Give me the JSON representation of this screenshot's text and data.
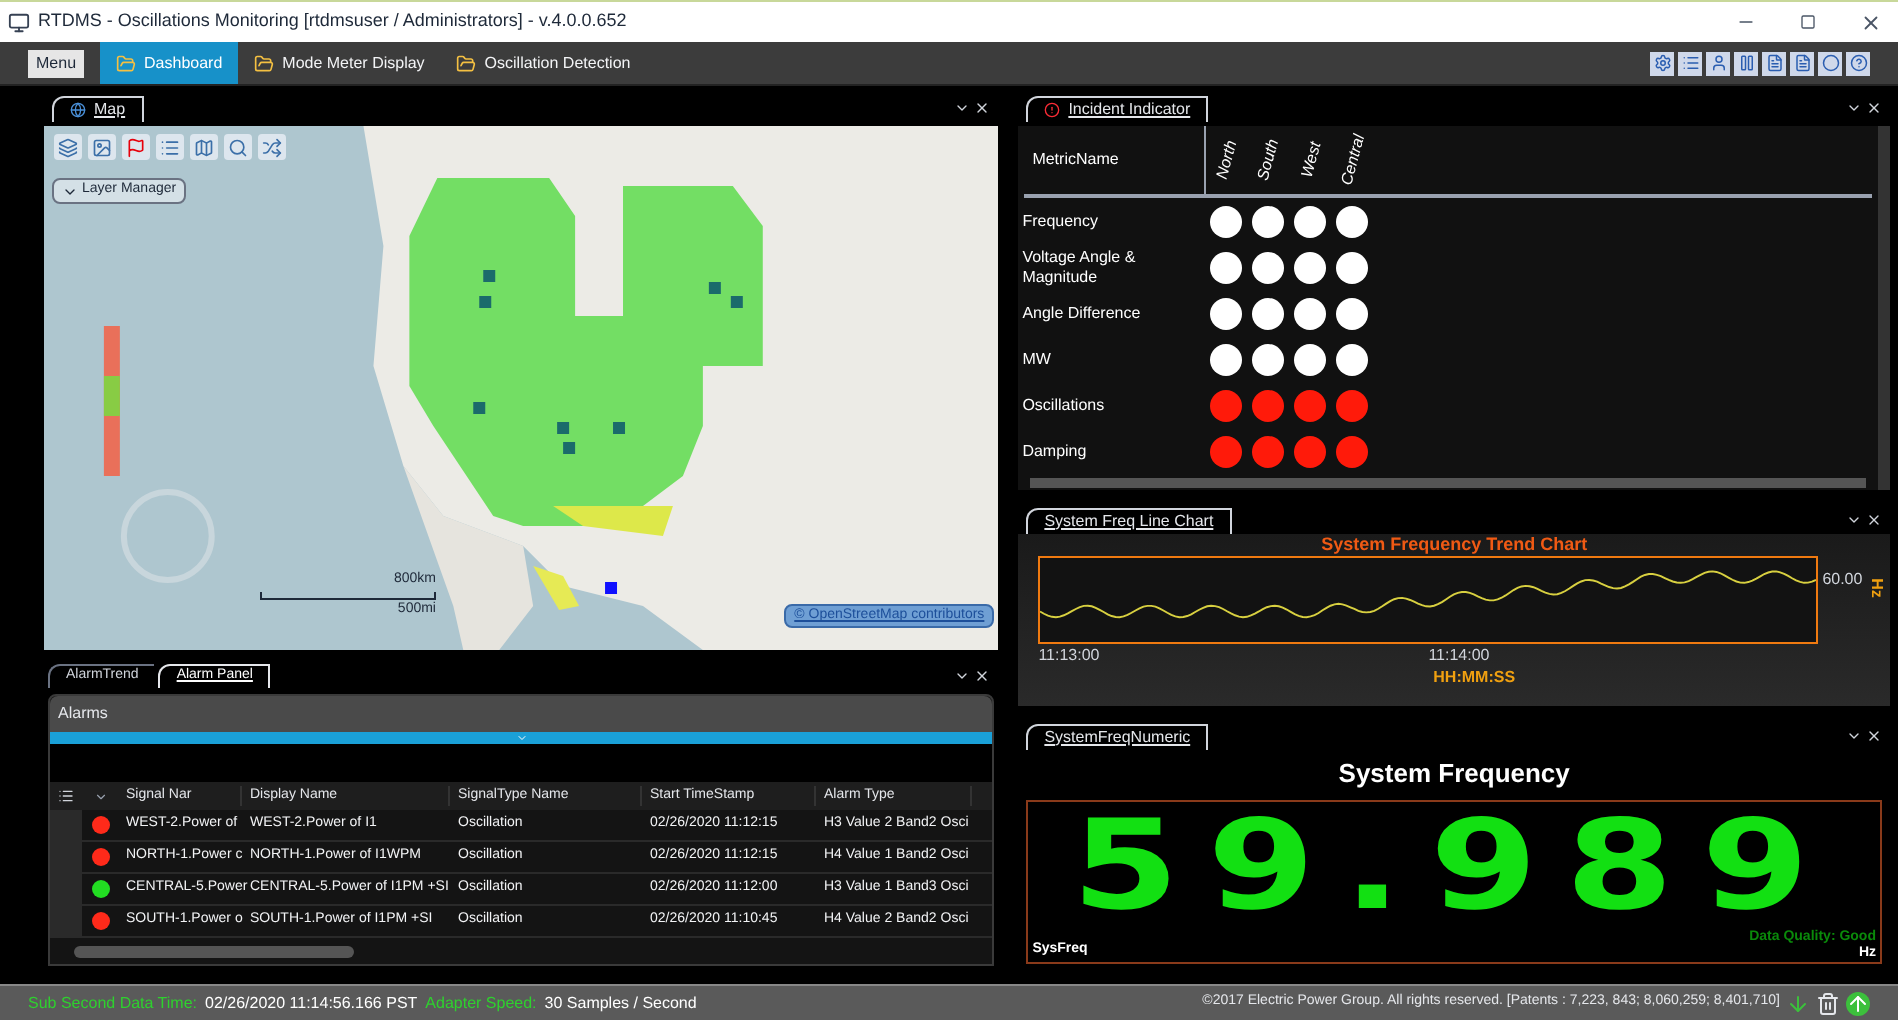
{
  "window": {
    "title": "RTDMS - Oscillations Monitoring [rtdmsuser / Administrators] - v.4.0.0.652"
  },
  "menu_button": "Menu",
  "tabs": [
    {
      "label": "Dashboard",
      "selected": true
    },
    {
      "label": "Mode Meter Display",
      "selected": false
    },
    {
      "label": "Oscillation Detection",
      "selected": false
    }
  ],
  "map_panel": {
    "tab": "Map",
    "layer_manager": "Layer Manager",
    "scale": [
      "800km",
      "500mi"
    ],
    "attribution": "© OpenStreetMap contributors"
  },
  "incident_panel": {
    "tab": "Incident Indicator",
    "header": "MetricName",
    "regions": [
      "North",
      "South",
      "West",
      "Central"
    ],
    "rows": [
      {
        "name": "Frequency",
        "alarms": [
          false,
          false,
          false,
          false
        ]
      },
      {
        "name": "Voltage Angle & Magnitude",
        "alarms": [
          false,
          false,
          false,
          false
        ]
      },
      {
        "name": "Angle Difference",
        "alarms": [
          false,
          false,
          false,
          false
        ]
      },
      {
        "name": "MW",
        "alarms": [
          false,
          false,
          false,
          false
        ]
      },
      {
        "name": "Oscillations",
        "alarms": [
          true,
          true,
          true,
          true
        ]
      },
      {
        "name": "Damping",
        "alarms": [
          true,
          true,
          true,
          true
        ]
      }
    ]
  },
  "alarm_panel": {
    "tabs": [
      {
        "label": "AlarmTrend",
        "selected": false
      },
      {
        "label": "Alarm Panel",
        "selected": true
      }
    ],
    "title": "Alarms",
    "columns": [
      "Signal Nar",
      "Display Name",
      "SignalType Name",
      "Start TimeStamp",
      "Alarm Type"
    ],
    "rows": [
      {
        "color": "#ff2a1a",
        "cells": [
          "WEST-2.Power of",
          "WEST-2.Power of I1",
          "Oscillation",
          "02/26/2020 11:12:15",
          "H3 Value 2 Band2 Osci"
        ]
      },
      {
        "color": "#ff2a1a",
        "cells": [
          "NORTH-1.Power c",
          "NORTH-1.Power of I1WPM",
          "Oscillation",
          "02/26/2020 11:12:15",
          "H4 Value 1 Band2 Osci"
        ]
      },
      {
        "color": "#22dd22",
        "cells": [
          "CENTRAL-5.Power",
          "CENTRAL-5.Power of I1PM +SI",
          "Oscillation",
          "02/26/2020 11:12:00",
          "H3 Value 1 Band3 Osci"
        ]
      },
      {
        "color": "#ff2a1a",
        "cells": [
          "SOUTH-1.Power o",
          "SOUTH-1.Power of I1PM +SI",
          "Oscillation",
          "02/26/2020 11:10:45",
          "H4 Value 2 Band2 Osci"
        ]
      }
    ]
  },
  "freq_chart_panel": {
    "tab": "System Freq Line Chart",
    "title": "System Frequency Trend Chart",
    "ytick": "60.00",
    "yunit": "Hz",
    "xticks": [
      "11:13:00",
      "11:14:00"
    ],
    "xlabel": "HH:MM:SS"
  },
  "numeric_panel": {
    "tab": "SystemFreqNumeric",
    "title": "System Frequency",
    "value": "59.989",
    "signal": "SysFreq",
    "quality": "Data Quality: Good",
    "unit": "Hz"
  },
  "status_bar": {
    "items": [
      {
        "label": "Sub Second Data Time:",
        "value": "02/26/2020 11:14:56.166 PST"
      },
      {
        "label": "Adapter Speed:",
        "value": "30 Samples / Second"
      }
    ],
    "copyright": "©2017 Electric Power Group. All rights reserved. [Patents : 7,223, 843; 8,060,259; 8,401,710]"
  }
}
